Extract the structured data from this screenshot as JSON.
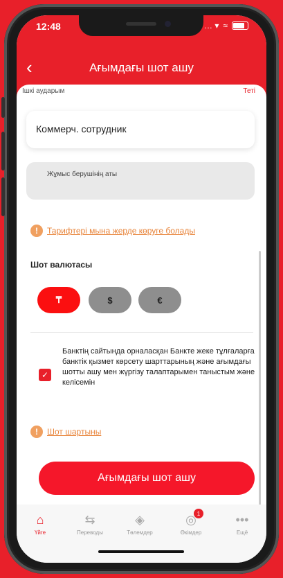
{
  "status": {
    "time": "12:48",
    "signal": "… ▾",
    "wifi": "≈"
  },
  "header": {
    "back": "‹",
    "title": "Ағымдағы шот ашу"
  },
  "top_row": {
    "left": "Ішкі аударым",
    "right": "Теті"
  },
  "fields": {
    "position_value": "Коммерч. сотрудник",
    "employer_placeholder": "Жұмыс берушінің аты"
  },
  "tariff_link": "Тарифтері мына жерде көруге болады",
  "currency_section": {
    "label": "Шот валютасы",
    "options": [
      "₸",
      "$",
      "€"
    ],
    "selected": "₸"
  },
  "agreement": {
    "checked": true,
    "check_mark": "✓",
    "text": "Банктің сайтында орналасқан Банкте жеке тұлғаларға банктік қызмет көрсету шарттарының және ағымдағы шотты ашу мен жүргізу талаптарымен таныстым және келісемін"
  },
  "contract_link": "Шот шартыны",
  "info_icon": "!",
  "submit_label": "Ағымдағы шот ашу",
  "tabbar": {
    "items": [
      {
        "label": "Үйге",
        "icon": "home-icon",
        "glyph": "⌂"
      },
      {
        "label": "Переводы",
        "icon": "transfer-icon",
        "glyph": "⇆"
      },
      {
        "label": "Төлемдер",
        "icon": "payments-icon",
        "glyph": "◈"
      },
      {
        "label": "Өкімдер",
        "icon": "services-icon",
        "glyph": "◎",
        "badge": "1"
      },
      {
        "label": "Ещё",
        "icon": "more-icon",
        "glyph": "•••"
      }
    ]
  },
  "colors": {
    "brand": "#e8202a",
    "link": "#e8843a",
    "inactive_currency": "#8e8e8e"
  }
}
